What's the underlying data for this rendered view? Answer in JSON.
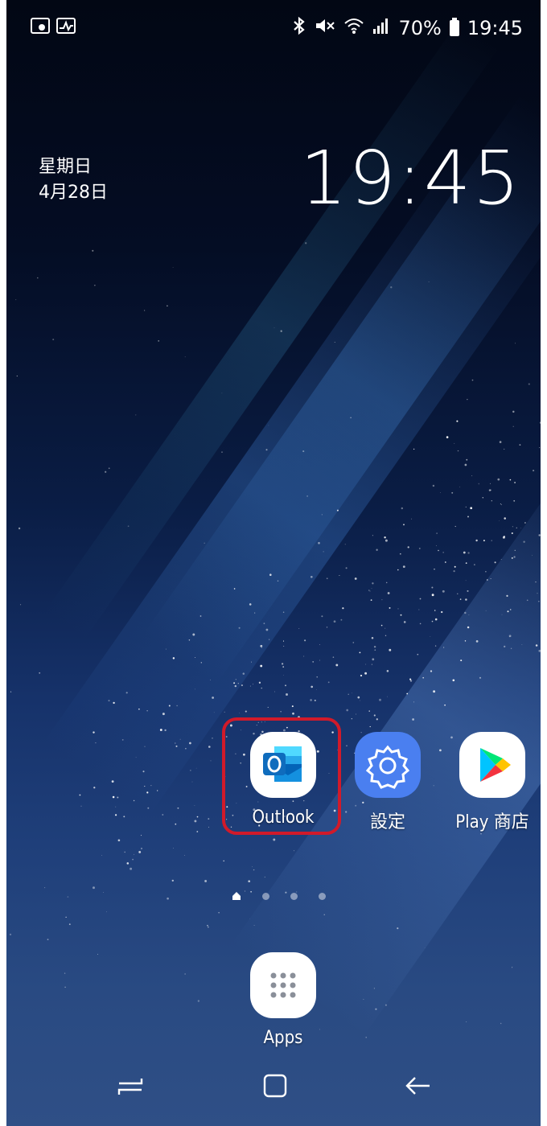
{
  "status_bar": {
    "battery_percent": "70%",
    "time": "19:45",
    "icons": [
      "screenshot-icon",
      "activity-icon",
      "bluetooth-icon",
      "mute-icon",
      "wifi-icon",
      "signal-icon",
      "battery-icon"
    ]
  },
  "clock_widget": {
    "weekday": "星期日",
    "date": "4月28日",
    "time": "19:45"
  },
  "apps": [
    {
      "label": "Outlook",
      "icon": "outlook-icon",
      "highlighted": true
    },
    {
      "label": "設定",
      "icon": "settings-icon"
    },
    {
      "label": "Play 商店",
      "icon": "play-store-icon"
    }
  ],
  "page_indicator": {
    "pages": 4,
    "current": 0
  },
  "dock": {
    "apps_label": "Apps"
  },
  "nav_bar": [
    "recents-button",
    "home-button",
    "back-button"
  ],
  "colors": {
    "highlight": "#d11a2a",
    "outlook_blue": "#0f6cbd",
    "settings_blue": "#4a7ff0"
  }
}
